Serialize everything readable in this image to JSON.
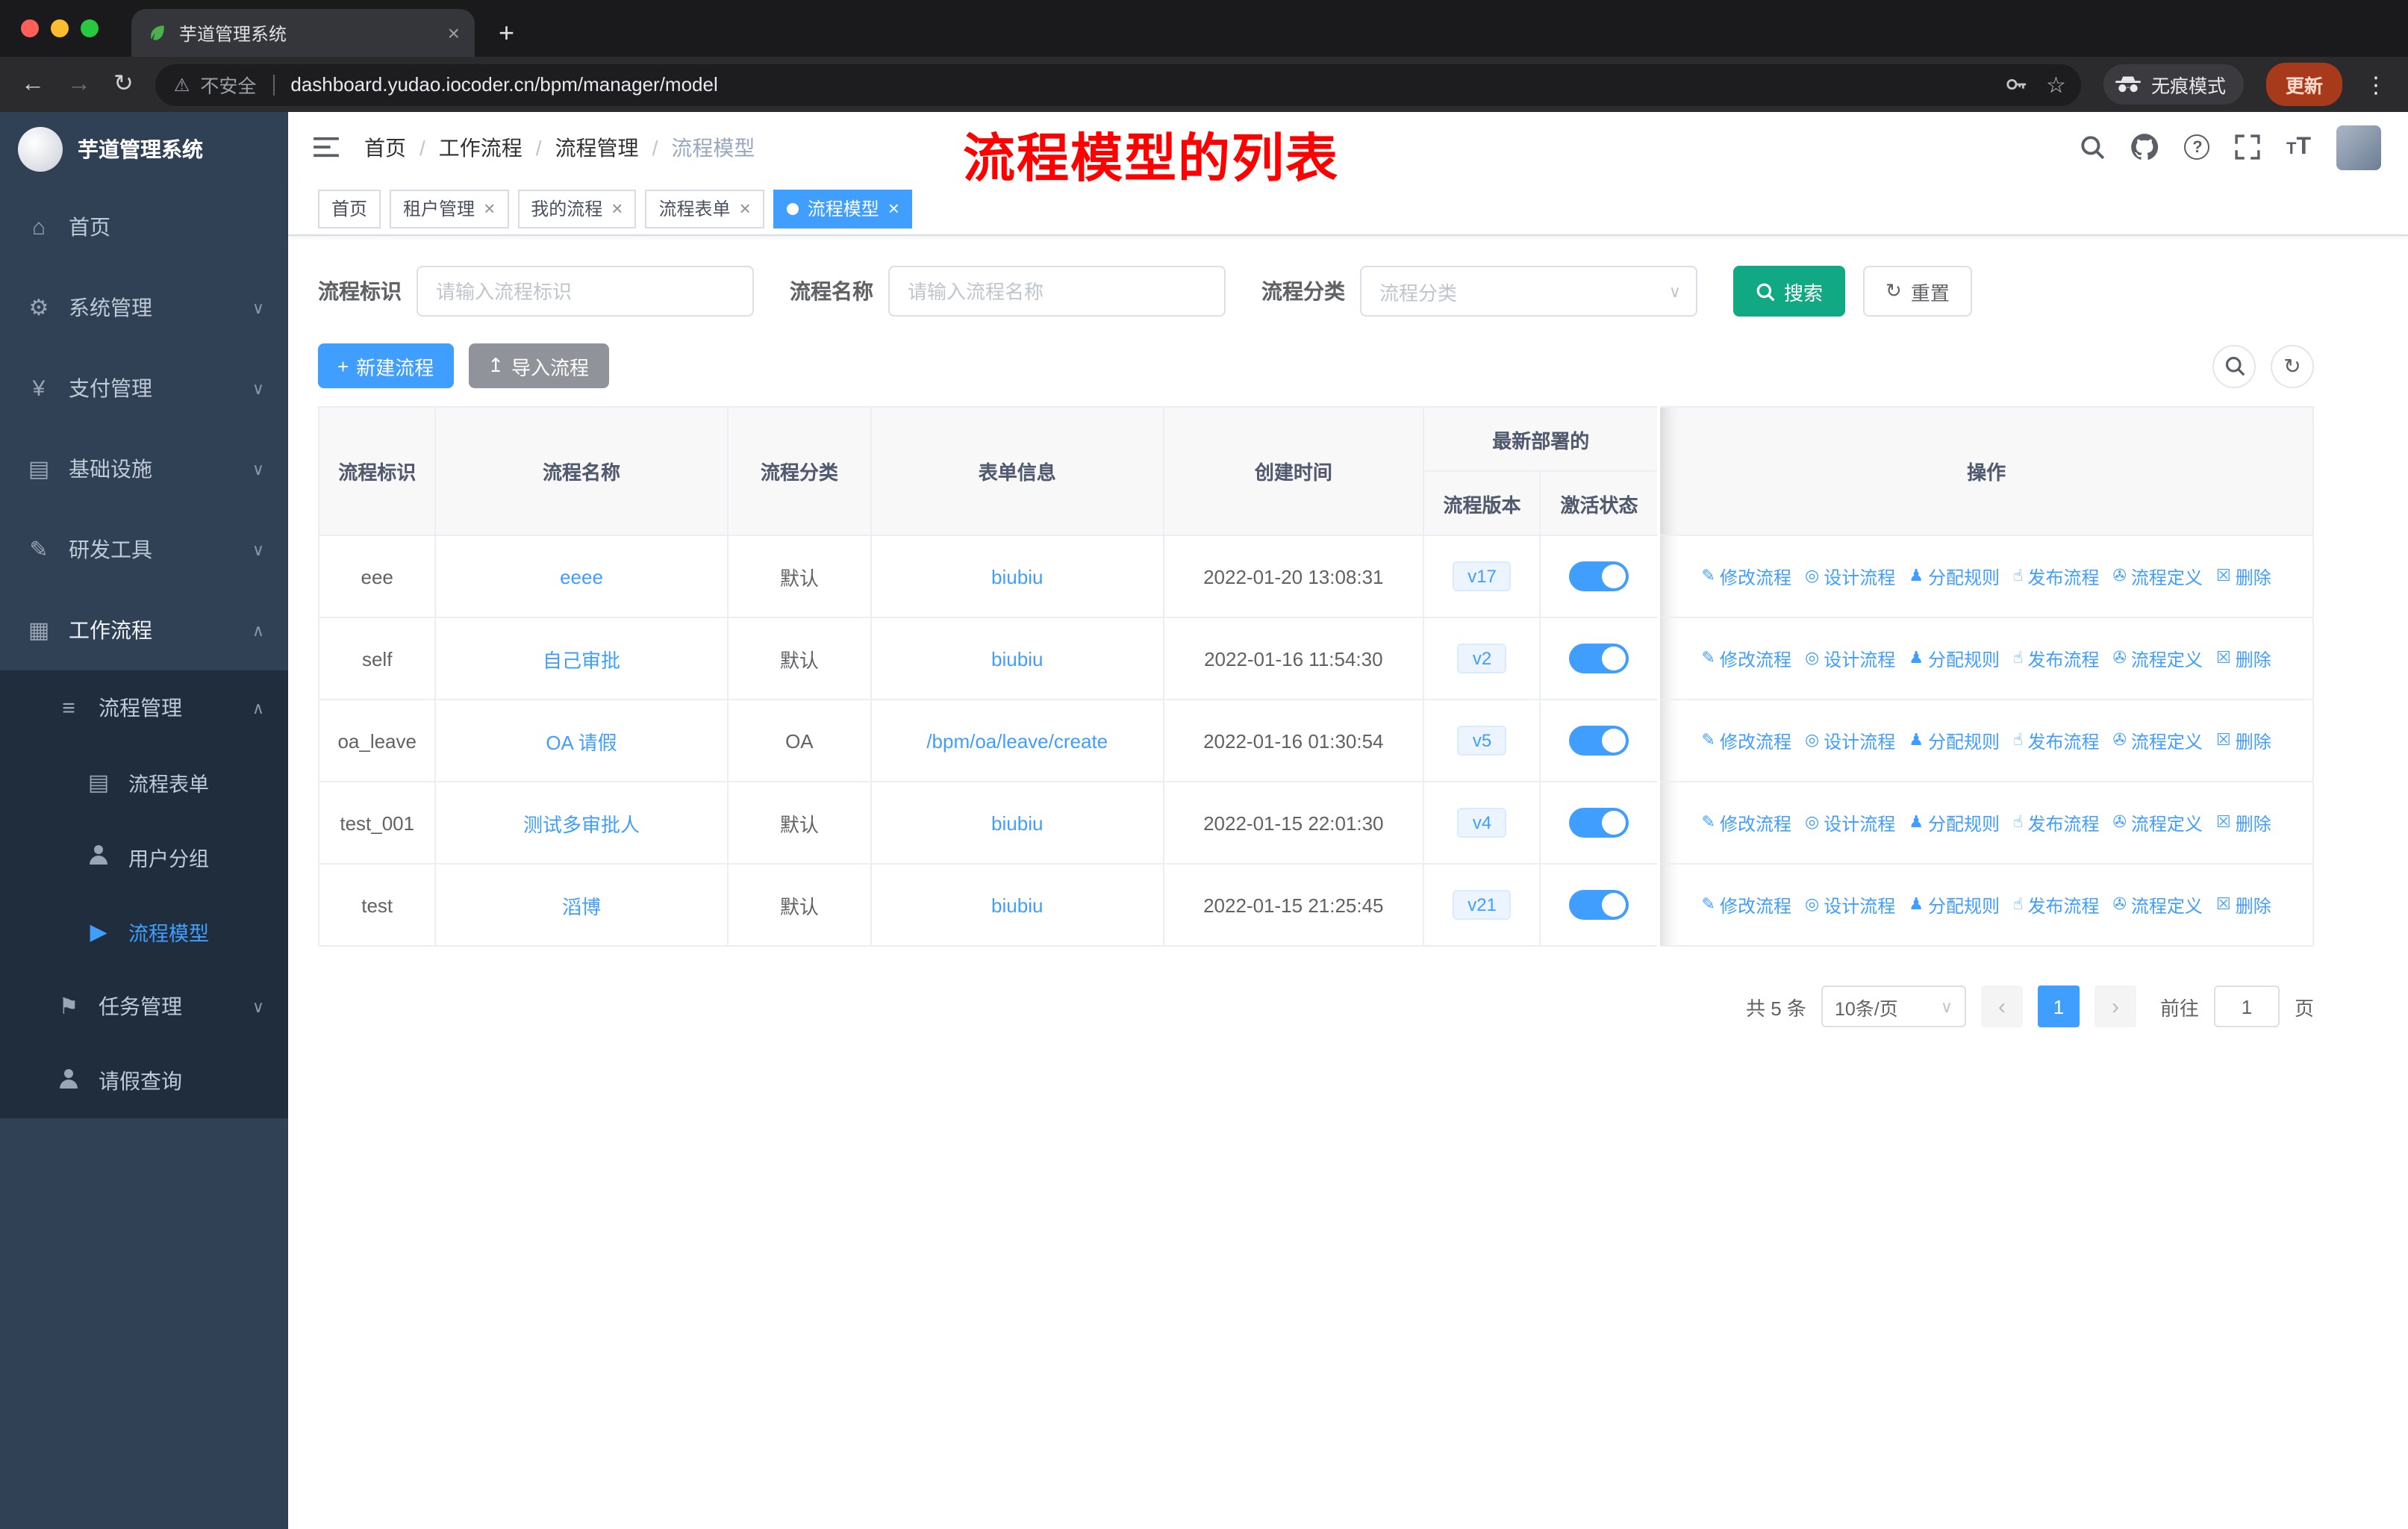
{
  "colors": {
    "primary": "#409EFF",
    "search_button": "#11A983",
    "sidebar_bg": "#304156",
    "submenu_bg": "#1F2D3D",
    "annotation": "#FF0000",
    "update_chip": "#A63A1B"
  },
  "icons": {
    "home": "⌂",
    "system": "⚙",
    "pay": "¥",
    "infra": "▤",
    "dev": "✎",
    "work": "▦",
    "manage": "≡",
    "form": "▤",
    "model": "▶",
    "task": "⚑",
    "edit": "✎",
    "design": "◎",
    "assign": "♟",
    "publish": "☝",
    "definition": "✇",
    "remove": "☒",
    "close": "×",
    "add": "+",
    "upload": "↥",
    "refresh": "↻",
    "back": "←",
    "forward": "→",
    "warning": "⚠",
    "star": "☆",
    "dot_menu": "⋮",
    "chevron_down": "∨",
    "chevron_up": "∧",
    "prev": "‹",
    "next": "›",
    "separator": "/",
    "help": "?"
  },
  "browser": {
    "tab_title": "芋道管理系统",
    "security_text": "不安全",
    "url": "dashboard.yudao.iocoder.cn/bpm/manager/model",
    "incognito_label": "无痕模式",
    "update_label": "更新"
  },
  "sidebar": {
    "title": "芋道管理系统",
    "items": [
      {
        "label": "首页"
      },
      {
        "label": "系统管理"
      },
      {
        "label": "支付管理"
      },
      {
        "label": "基础设施"
      },
      {
        "label": "研发工具"
      },
      {
        "label": "工作流程"
      }
    ],
    "submenu": {
      "manage_label": "流程管理",
      "children": [
        {
          "label": "流程表单"
        },
        {
          "label": "用户分组"
        },
        {
          "label": "流程模型"
        }
      ],
      "task_label": "任务管理",
      "leave_label": "请假查询"
    }
  },
  "header": {
    "breadcrumb": [
      "首页",
      "工作流程",
      "流程管理",
      "流程模型"
    ],
    "annotation": "流程模型的列表"
  },
  "tags": [
    {
      "label": "首页"
    },
    {
      "label": "租户管理"
    },
    {
      "label": "我的流程"
    },
    {
      "label": "流程表单"
    },
    {
      "label": "流程模型"
    }
  ],
  "filters": {
    "key_label": "流程标识",
    "key_placeholder": "请输入流程标识",
    "name_label": "流程名称",
    "name_placeholder": "请输入流程名称",
    "category_label": "流程分类",
    "category_placeholder": "流程分类",
    "search_label": "搜索",
    "reset_label": "重置"
  },
  "toolbar": {
    "create_label": "新建流程",
    "import_label": "导入流程"
  },
  "table": {
    "headers": {
      "key": "流程标识",
      "name": "流程名称",
      "category": "流程分类",
      "form": "表单信息",
      "created": "创建时间",
      "deploy_group": "最新部署的",
      "version": "流程版本",
      "status": "激活状态",
      "actions": "操作"
    },
    "row_actions": [
      "修改流程",
      "设计流程",
      "分配规则",
      "发布流程",
      "流程定义",
      "删除"
    ],
    "rows": [
      {
        "key": "eee",
        "name": "eeee",
        "category": "默认",
        "form": "biubiu",
        "created": "2022-01-20 13:08:31",
        "version": "v17",
        "active": true
      },
      {
        "key": "self",
        "name": "自己审批",
        "category": "默认",
        "form": "biubiu",
        "created": "2022-01-16 11:54:30",
        "version": "v2",
        "active": true
      },
      {
        "key": "oa_leave",
        "name": "OA 请假",
        "category": "OA",
        "form": "/bpm/oa/leave/create",
        "created": "2022-01-16 01:30:54",
        "version": "v5",
        "active": true
      },
      {
        "key": "test_001",
        "name": "测试多审批人",
        "category": "默认",
        "form": "biubiu",
        "created": "2022-01-15 22:01:30",
        "version": "v4",
        "active": true
      },
      {
        "key": "test",
        "name": "滔博",
        "category": "默认",
        "form": "biubiu",
        "created": "2022-01-15 21:25:45",
        "version": "v21",
        "active": true
      }
    ]
  },
  "pagination": {
    "total": "共 5 条",
    "page_size": "10条/页",
    "current_page": "1",
    "goto_label": "前往",
    "goto_value": "1",
    "page_unit": "页"
  }
}
